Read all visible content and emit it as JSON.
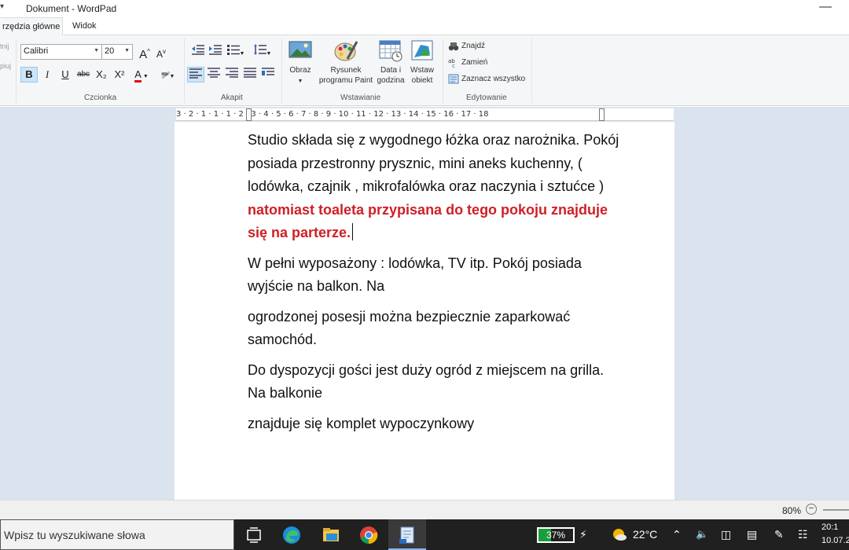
{
  "window": {
    "title": "Dokument - WordPad"
  },
  "ribbon": {
    "tabs": [
      {
        "label": "rzędzia główne",
        "active": true
      },
      {
        "label": "Widok",
        "active": false
      }
    ],
    "clipboard_cut_labels": [
      "tnij",
      "piuj"
    ],
    "font": {
      "family": "Calibri",
      "size": "20",
      "group_label": "Czcionka",
      "buttons": [
        "B",
        "I",
        "U",
        "abc",
        "X₂",
        "X²",
        "A"
      ]
    },
    "paragraph": {
      "group_label": "Akapit"
    },
    "insert": {
      "group_label": "Wstawianie",
      "picture_label": "Obraz",
      "paint_label_1": "Rysunek",
      "paint_label_2": "programu Paint",
      "datetime_label_1": "Data i",
      "datetime_label_2": "godzina",
      "object_label_1": "Wstaw",
      "object_label_2": "obiekt"
    },
    "editing": {
      "group_label": "Edytowanie",
      "find_label": "Znajdź",
      "replace_label": "Zamień",
      "select_all_label": "Zaznacz wszystko"
    }
  },
  "ruler": {
    "marks": "3 · 2 · 1 · 1 · 1 · 2 · 3 · 4 · 5 · 6 · 7 · 8 · 9 · 10 · 11 · 12 · 13 · 14 · 15 · 16 · 17 · 18"
  },
  "document": {
    "p1_normal": "Studio składa się z wygodnego łóżka oraz narożnika. Pokój posiada przestronny prysznic, mini aneks kuchenny, ( lodówka, czajnik , mikrofalówka oraz naczynia i sztućce ) ",
    "p1_red": "natomiast toaleta przypisana do tego pokoju znajduje się na parterze.",
    "p2": "W pełni wyposażony : lodówka, TV itp. Pokój posiada wyjście na balkon. Na",
    "p3": "ogrodzonej posesji można bezpiecznie zaparkować samochód.",
    "p4": "Do dyspozycji gości jest duży ogród z miejscem na grilla. Na balkonie",
    "p5": "znajduje się komplet wypoczynkowy",
    "red_color": "#cf1f25"
  },
  "statusbar": {
    "zoom": "80%"
  },
  "taskbar": {
    "search_placeholder": "Wpisz tu wyszukiwane słowa",
    "battery": "37%",
    "battery_level": 0.37,
    "temperature": "22°C",
    "time": "20:1",
    "date": "10.07.2"
  }
}
